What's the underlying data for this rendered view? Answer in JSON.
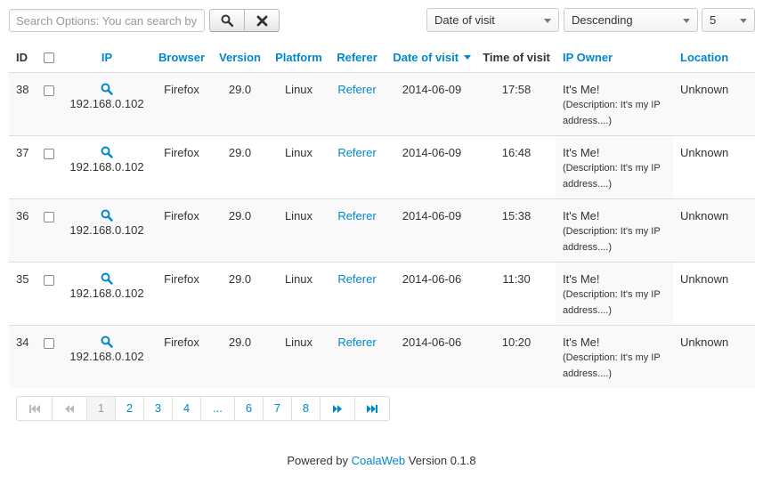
{
  "toolbar": {
    "search_placeholder": "Search Options: You can search by",
    "search_button_icon": "search-icon",
    "clear_button_icon": "close-icon",
    "order_select": "Date of visit",
    "direction_select": "Descending",
    "limit_select": "5"
  },
  "table": {
    "headers": {
      "id": "ID",
      "ip": "IP",
      "browser": "Browser",
      "version": "Version",
      "platform": "Platform",
      "referer": "Referer",
      "date": "Date of visit",
      "time": "Time of visit",
      "owner": "IP Owner",
      "location": "Location"
    },
    "rows": [
      {
        "id": "38",
        "ip": "192.168.0.102",
        "browser": "Firefox",
        "version": "29.0",
        "platform": "Linux",
        "referer": "Referer",
        "date": "2014-06-09",
        "time": "17:58",
        "owner": "It's Me!",
        "owner_desc_1": "(Description: It's my IP",
        "owner_desc_2": "address....)",
        "location": "Unknown"
      },
      {
        "id": "37",
        "ip": "192.168.0.102",
        "browser": "Firefox",
        "version": "29.0",
        "platform": "Linux",
        "referer": "Referer",
        "date": "2014-06-09",
        "time": "16:48",
        "owner": "It's Me!",
        "owner_desc_1": "(Description: It's my IP",
        "owner_desc_2": "address....)",
        "location": "Unknown"
      },
      {
        "id": "36",
        "ip": "192.168.0.102",
        "browser": "Firefox",
        "version": "29.0",
        "platform": "Linux",
        "referer": "Referer",
        "date": "2014-06-09",
        "time": "15:38",
        "owner": "It's Me!",
        "owner_desc_1": "(Description: It's my IP",
        "owner_desc_2": "address....)",
        "location": "Unknown"
      },
      {
        "id": "35",
        "ip": "192.168.0.102",
        "browser": "Firefox",
        "version": "29.0",
        "platform": "Linux",
        "referer": "Referer",
        "date": "2014-06-06",
        "time": "11:30",
        "owner": "It's Me!",
        "owner_desc_1": "(Description: It's my IP",
        "owner_desc_2": "address....)",
        "location": "Unknown"
      },
      {
        "id": "34",
        "ip": "192.168.0.102",
        "browser": "Firefox",
        "version": "29.0",
        "platform": "Linux",
        "referer": "Referer",
        "date": "2014-06-06",
        "time": "10:20",
        "owner": "It's Me!",
        "owner_desc_1": "(Description: It's my IP",
        "owner_desc_2": "address....)",
        "location": "Unknown"
      }
    ]
  },
  "pagination": {
    "first_icon": "first-page-icon",
    "prev_icon": "previous-page-icon",
    "pages": [
      "1",
      "2",
      "3",
      "4",
      "...",
      "6",
      "7",
      "8"
    ],
    "current": "1",
    "next_icon": "next-page-icon",
    "last_icon": "last-page-icon"
  },
  "footer": {
    "prefix": "Powered by",
    "link": "CoalaWeb",
    "suffix": "Version 0.1.8"
  },
  "colors": {
    "link": "#0088cc",
    "stripe": "#f9f9f9",
    "border": "#dddddd"
  }
}
